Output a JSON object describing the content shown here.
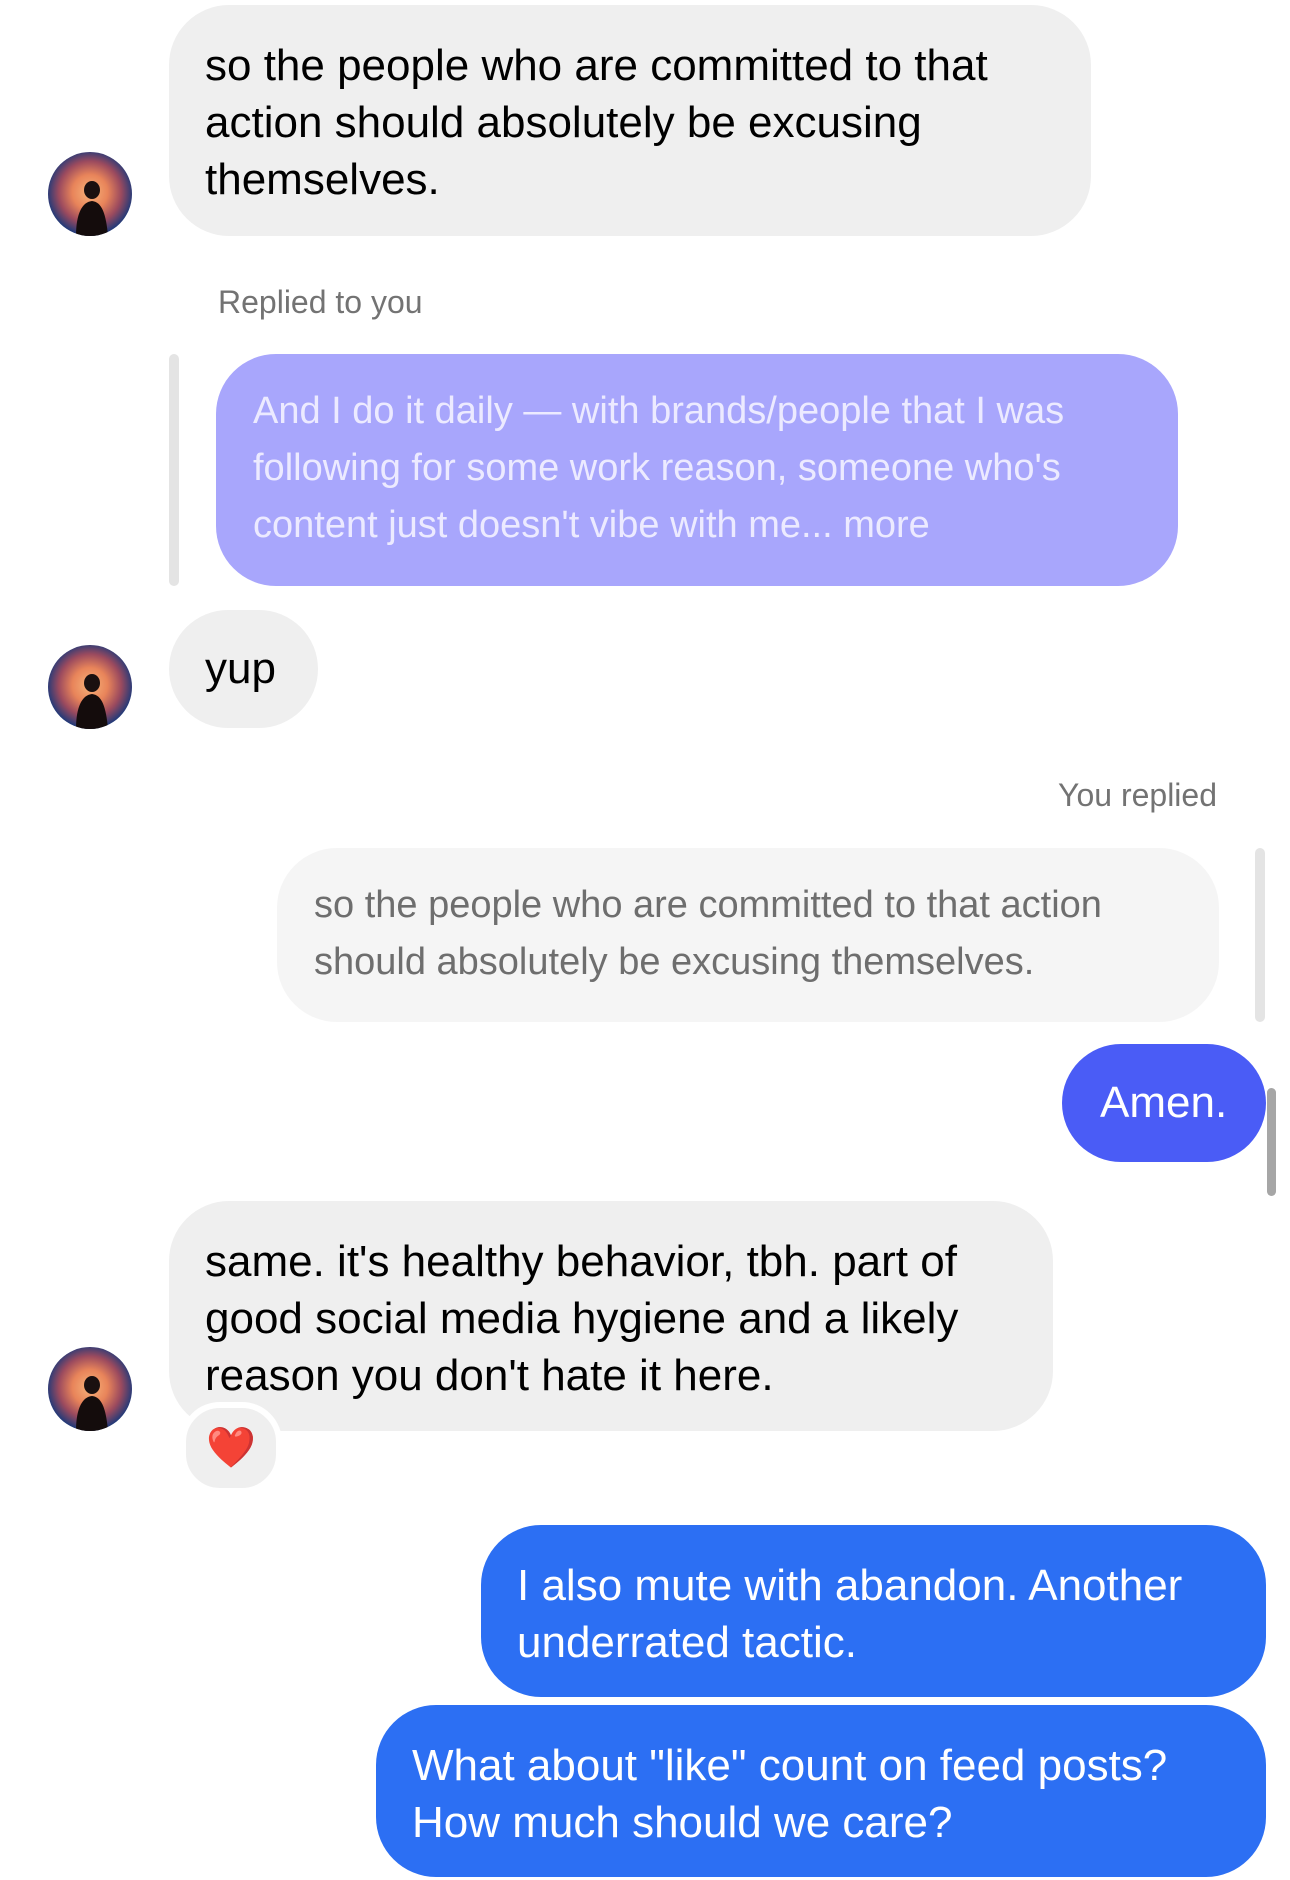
{
  "colors": {
    "incoming_bubble": "#efefef",
    "outgoing_indigo": "#4a5cf6",
    "outgoing_blue": "#2c6ff3",
    "quoted_outgoing": "#a8a6fc",
    "quoted_incoming": "#f5f5f5",
    "meta_text": "#737373"
  },
  "messages": {
    "m1": {
      "text": "so the people who are committed to that\naction should absolutely be excusing\nthemselves."
    },
    "reply_label_1": "Replied to you",
    "quote_1": {
      "text": "And I do it daily — with brands/people that I was\nfollowing for some work reason, someone who's\ncontent just doesn't vibe with me... more"
    },
    "m2": {
      "text": "yup"
    },
    "reply_label_2": "You replied",
    "quote_2": {
      "text": "so the people who are committed to that action\nshould absolutely be excusing themselves."
    },
    "m3": {
      "text": "Amen."
    },
    "m4": {
      "text": "same. it's healthy behavior, tbh. part of\ngood social media hygiene and a likely\nreason you don't hate it here."
    },
    "m4_reaction": "❤️",
    "m5": {
      "text": "I also mute with abandon. Another\nunderrated tactic."
    },
    "m6": {
      "text": "What about \"like\" count on feed posts?\nHow much should we care?"
    }
  },
  "icons": {
    "avatar": "contact-avatar",
    "reaction": "red-heart-emoji"
  }
}
